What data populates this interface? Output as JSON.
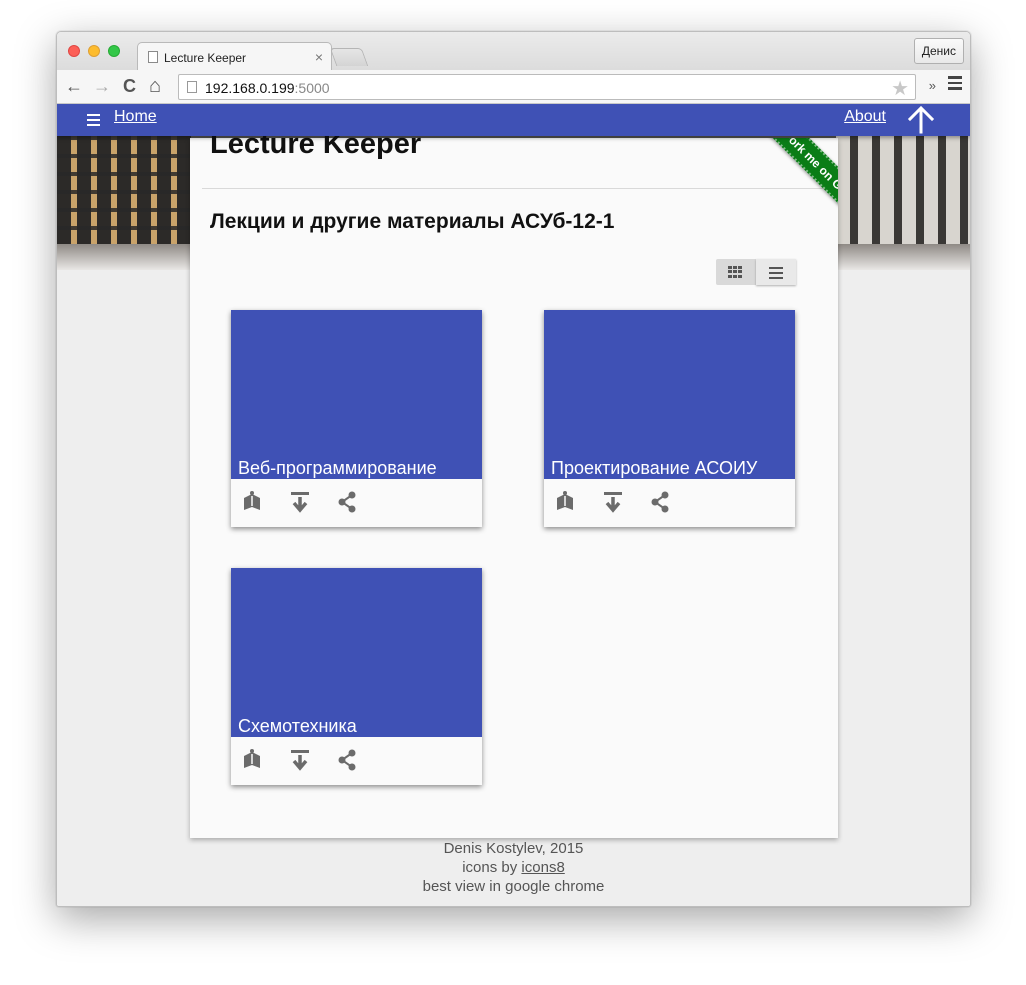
{
  "browser": {
    "tab_title": "Lecture Keeper",
    "tab_close": "×",
    "profile_name": "Денис",
    "url_host": "192.168.0.199",
    "url_port": ":5000",
    "back": "←",
    "forward": "→",
    "reload": "C",
    "home": "⌂",
    "star": "★",
    "extensions": "»"
  },
  "appbar": {
    "home_label": "Home",
    "about_label": "About",
    "color": "#3f51b5"
  },
  "page": {
    "site_title": "Lecture Keeper",
    "heading": "Лекции и другие материалы АСУб-12-1",
    "ribbon_text": "Fork me on GitHub"
  },
  "courses": [
    {
      "title": "Веб-программирование"
    },
    {
      "title": "Проектирование АСОИУ"
    },
    {
      "title": "Схемотехника"
    }
  ],
  "icons": {
    "card_actions": [
      "open-book-icon",
      "download-icon",
      "share-icon"
    ],
    "view_toggle": [
      "grid-view-icon",
      "list-view-icon"
    ]
  },
  "footer": {
    "line1": "Denis Kostylev, 2015",
    "line2_prefix": "icons by ",
    "line2_link": "icons8",
    "line3": "best view in google chrome"
  }
}
